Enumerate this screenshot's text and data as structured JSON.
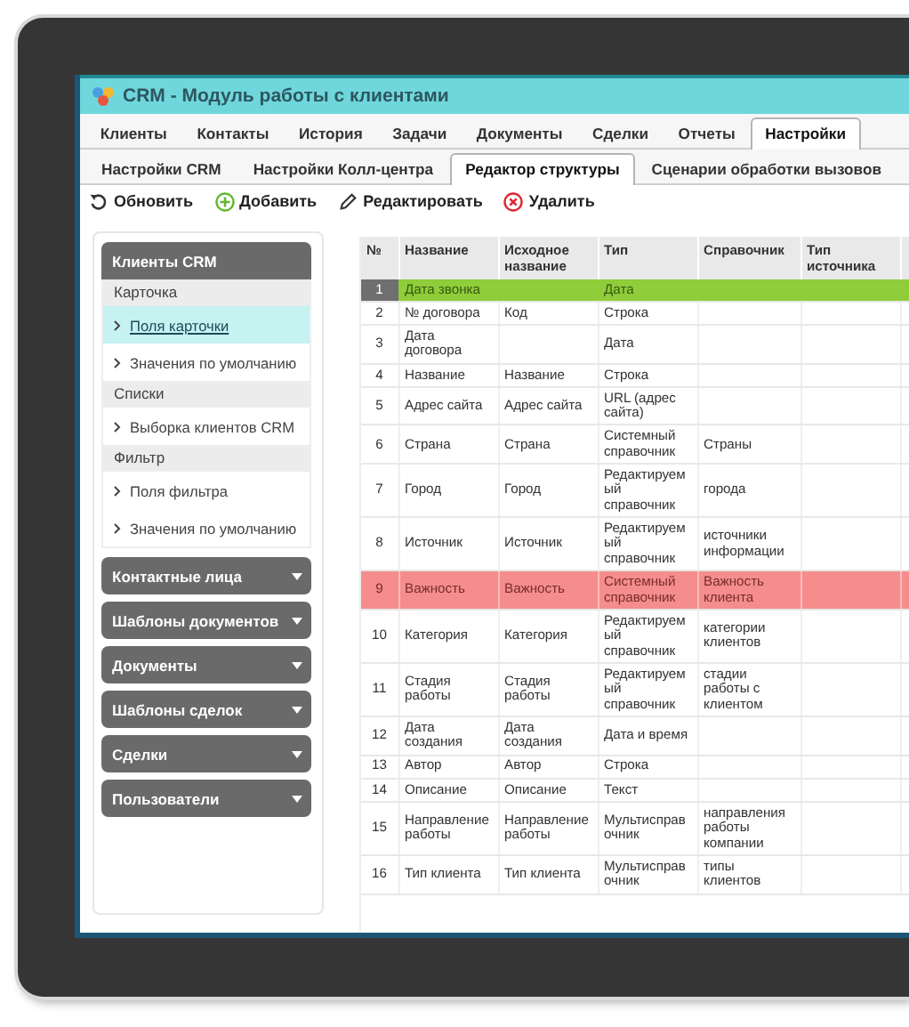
{
  "window": {
    "title": "CRM - Модуль работы с клиентами"
  },
  "tabs": [
    {
      "label": "Клиенты",
      "selected": false
    },
    {
      "label": "Контакты",
      "selected": false
    },
    {
      "label": "История",
      "selected": false
    },
    {
      "label": "Задачи",
      "selected": false
    },
    {
      "label": "Документы",
      "selected": false
    },
    {
      "label": "Сделки",
      "selected": false
    },
    {
      "label": "Отчеты",
      "selected": false
    },
    {
      "label": "Настройки",
      "selected": true
    }
  ],
  "subtabs": [
    {
      "label": "Настройки CRM",
      "selected": false
    },
    {
      "label": "Настройки Колл-центра",
      "selected": false
    },
    {
      "label": "Редактор структуры",
      "selected": true
    },
    {
      "label": "Сценарии обработки вызовов",
      "selected": false
    }
  ],
  "toolbar": [
    {
      "kind": "refresh",
      "label": "Обновить"
    },
    {
      "kind": "add",
      "label": "Добавить"
    },
    {
      "kind": "edit",
      "label": "Редактировать"
    },
    {
      "kind": "delete",
      "label": "Удалить"
    }
  ],
  "sidebar": {
    "groups": [
      {
        "title": "Клиенты CRM",
        "expanded": true,
        "sections": [
          {
            "title": "Карточка",
            "items": [
              {
                "label": "Поля карточки",
                "selected": true
              },
              {
                "label": "Значения по умолчанию",
                "selected": false
              }
            ]
          },
          {
            "title": "Списки",
            "items": [
              {
                "label": "Выборка клиентов CRM",
                "selected": false
              }
            ]
          },
          {
            "title": "Фильтр",
            "items": [
              {
                "label": "Поля фильтра",
                "selected": false
              },
              {
                "label": "Значения по умолчанию",
                "selected": false
              }
            ]
          }
        ]
      },
      {
        "title": "Контактные лица",
        "expanded": false
      },
      {
        "title": "Шаблоны документов",
        "expanded": false
      },
      {
        "title": "Документы",
        "expanded": false
      },
      {
        "title": "Шаблоны сделок",
        "expanded": false
      },
      {
        "title": "Сделки",
        "expanded": false
      },
      {
        "title": "Пользователи",
        "expanded": false
      }
    ]
  },
  "table": {
    "columns": [
      "№",
      "Название",
      "Исходное название",
      "Тип",
      "Справочник",
      "Тип источника"
    ],
    "rows": [
      {
        "number": "1",
        "name": "Дата звонка",
        "type": "Дата",
        "selected": true,
        "flagged": false
      },
      {
        "number": "2",
        "name": "№ договора",
        "original_name": "Код",
        "type": "Строка",
        "selected": false,
        "flagged": false
      },
      {
        "number": "3",
        "name": "Дата договора",
        "type": "Дата",
        "selected": false,
        "flagged": false
      },
      {
        "number": "4",
        "name": "Название",
        "original_name": "Название",
        "type": "Строка",
        "selected": false,
        "flagged": false
      },
      {
        "number": "5",
        "name": "Адрес сайта",
        "original_name": "Адрес сайта",
        "type": "URL (адрес сайта)",
        "selected": false,
        "flagged": false
      },
      {
        "number": "6",
        "name": "Страна",
        "original_name": "Страна",
        "type": "Системный справочник",
        "directory": "Страны",
        "selected": false,
        "flagged": false
      },
      {
        "number": "7",
        "name": "Город",
        "original_name": "Город",
        "type": "Редактируемый справочник",
        "directory": "города",
        "selected": false,
        "flagged": false
      },
      {
        "number": "8",
        "name": "Источник",
        "original_name": "Источник",
        "type": "Редактируемый справочник",
        "directory": "источники информации",
        "selected": false,
        "flagged": false
      },
      {
        "number": "9",
        "name": "Важность",
        "original_name": "Важность",
        "type": "Системный справочник",
        "directory": "Важность клиента",
        "selected": false,
        "flagged": true
      },
      {
        "number": "10",
        "name": "Категория",
        "original_name": "Категория",
        "type": "Редактируемый справочник",
        "directory": "категории клиентов",
        "selected": false,
        "flagged": false
      },
      {
        "number": "11",
        "name": "Стадия работы",
        "original_name": "Стадия работы",
        "type": "Редактируемый справочник",
        "directory": "стадии работы с клиентом",
        "selected": false,
        "flagged": false
      },
      {
        "number": "12",
        "name": "Дата создания",
        "original_name": "Дата создания",
        "type": "Дата и время",
        "selected": false,
        "flagged": false
      },
      {
        "number": "13",
        "name": "Автор",
        "original_name": "Автор",
        "type": "Строка",
        "selected": false,
        "flagged": false
      },
      {
        "number": "14",
        "name": "Описание",
        "original_name": "Описание",
        "type": "Текст",
        "selected": false,
        "flagged": false
      },
      {
        "number": "15",
        "name": "Направление работы",
        "original_name": "Направление работы",
        "type": "Мультисправочник",
        "directory": "направления работы компании",
        "selected": false,
        "flagged": false
      },
      {
        "number": "16",
        "name": "Тип клиента",
        "original_name": "Тип клиента",
        "type": "Мультисправочник",
        "directory": "типы клиентов",
        "selected": false,
        "flagged": false
      }
    ]
  }
}
